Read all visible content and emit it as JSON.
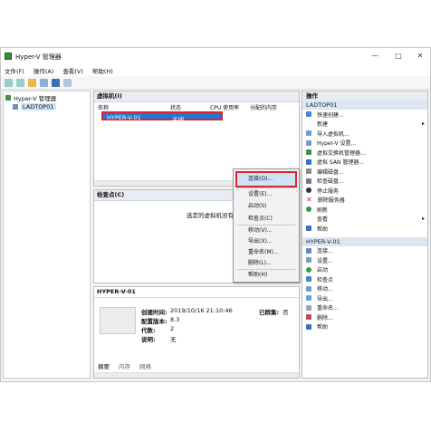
{
  "window": {
    "title": "Hyper-V 管理器",
    "buttons": {
      "minimize": "—",
      "maximize": "□",
      "close": "✕"
    }
  },
  "menubar": {
    "items": [
      "文件(F)",
      "操作(A)",
      "查看(V)",
      "帮助(H)"
    ]
  },
  "tree": {
    "root": "Hyper-V 管理器",
    "host": "LADTOP01"
  },
  "vms": {
    "header": "虚拟机(I)",
    "columns": [
      "名称",
      "状态",
      "CPU 使用率",
      "分配的内存"
    ],
    "rows": [
      {
        "name": "HYPER-V-01",
        "state": "关闭"
      }
    ]
  },
  "checkpoints": {
    "header": "检查点(C)",
    "empty_text": "选定的虚拟机没有"
  },
  "details": {
    "header": "HYPER-V-01",
    "created_label": "创建时间:",
    "created_value": "2019/10/16 21:10:46",
    "config_label": "配置版本:",
    "config_value": "8.3",
    "gen_label": "代数:",
    "gen_value": "2",
    "notes_label": "说明:",
    "notes_value": "无",
    "clustered_label": "已群集:",
    "clustered_value": "否",
    "tabs": [
      "摘要",
      "内存",
      "网络"
    ]
  },
  "context_menu": {
    "items": [
      "连接(O)...",
      "设置(E)...",
      "启动(S)",
      "检查点(C)",
      "移动(V)...",
      "导出(X)...",
      "重命名(M)...",
      "删除(L)...",
      "帮助(H)"
    ]
  },
  "actions": {
    "header": "操作",
    "host_section": "LADTOP01",
    "host_items": [
      "快速创建...",
      "新建",
      "导入虚拟机...",
      "Hyper-V 设置...",
      "虚拟交换机管理器...",
      "虚拟 SAN 管理器...",
      "编辑磁盘...",
      "检查磁盘...",
      "停止服务",
      "删除服务器",
      "刷新",
      "查看",
      "帮助"
    ],
    "vm_section": "HYPER-V-01",
    "vm_items": [
      "连接...",
      "设置...",
      "启动",
      "检查点",
      "移动...",
      "导出...",
      "重命名...",
      "删除...",
      "帮助"
    ]
  },
  "colors": {
    "selection": "#1e78d7",
    "highlight_border": "#e0242e",
    "section_bg": "#dce5f2"
  }
}
